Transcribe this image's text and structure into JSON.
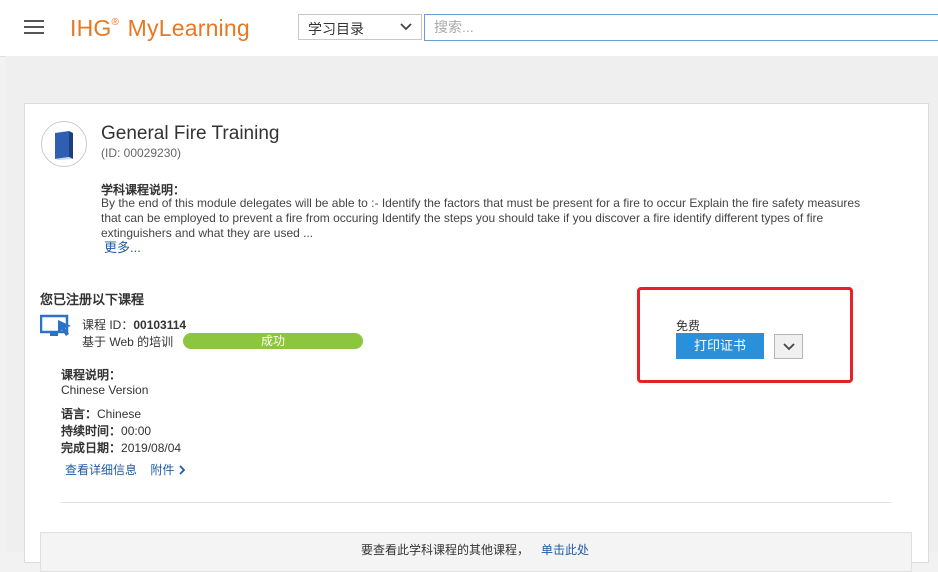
{
  "header": {
    "logo_text": "IHG",
    "logo_mark": "®",
    "logo_product": "MyLearning",
    "catalog_select": "学习目录",
    "search_placeholder": "搜索..."
  },
  "course": {
    "title": "General Fire Training",
    "id_text": "(ID: 00029230)",
    "description_label": "学科课程说明：",
    "description": "By the end of this module delegates will be able to :- Identify the factors that must be present for a fire to occur Explain the fire safety measures that can be employed to prevent a fire from occuring Identify the steps you should take if you discover a fire identify different types of fire extinguishers and what they are used ...",
    "more_link": "更多..."
  },
  "enrolled": {
    "heading": "您已注册以下课程",
    "offering_id_label": "课程 ID：",
    "offering_id": "00103114",
    "offering_type": "基于 Web 的培训",
    "status": "成功",
    "course_desc_label": "课程说明：",
    "course_desc": "Chinese Version",
    "language_label": "语言：",
    "language": "Chinese",
    "duration_label": "持续时间：",
    "duration": "00:00",
    "completion_label": "完成日期：",
    "completion_date": "2019/08/04",
    "details_link": "查看详细信息",
    "attachments_link": "附件"
  },
  "action": {
    "price": "免费",
    "print_button": "打印证书"
  },
  "footer": {
    "text": "要查看此学科课程的其他课程，",
    "link": "单击此处"
  },
  "colors": {
    "brand": "#e87722",
    "primary_button": "#2a90d9",
    "status_success": "#8cc63f",
    "link": "#1f5aa6",
    "highlight": "#e8202a"
  }
}
